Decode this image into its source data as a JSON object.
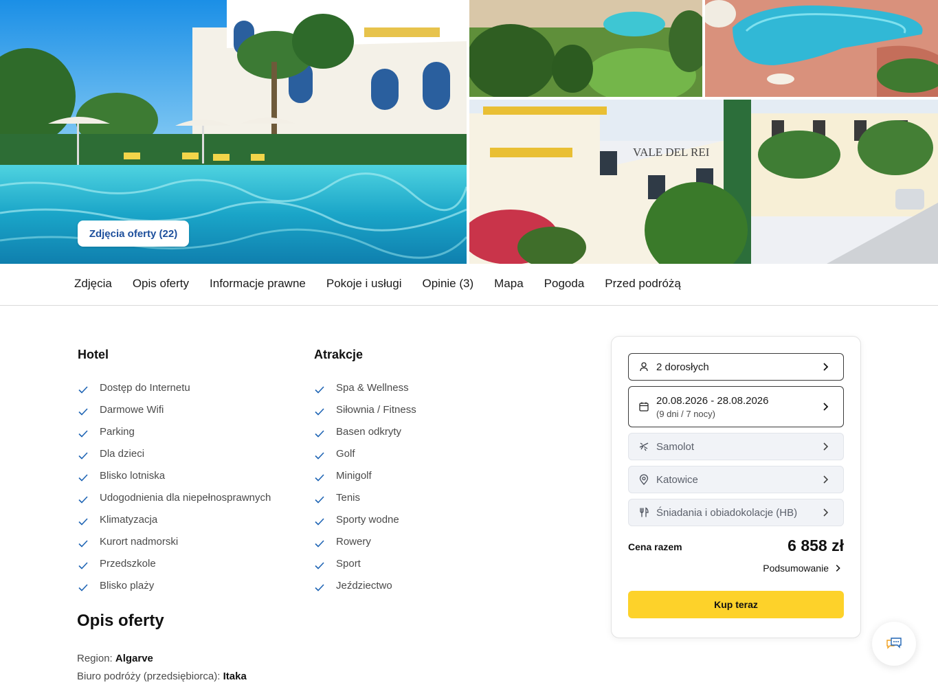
{
  "gallery": {
    "photos_button": "Zdjęcia oferty (22)",
    "sign_text": "VALE DEL REI"
  },
  "tabs": [
    {
      "label": "Zdjęcia"
    },
    {
      "label": "Opis oferty"
    },
    {
      "label": "Informacje prawne"
    },
    {
      "label": "Pokoje i usługi"
    },
    {
      "label": "Opinie (3)"
    },
    {
      "label": "Mapa"
    },
    {
      "label": "Pogoda"
    },
    {
      "label": "Przed podróżą"
    }
  ],
  "amenities": {
    "hotel": {
      "title": "Hotel",
      "items": [
        "Dostęp do Internetu",
        "Darmowe Wifi",
        "Parking",
        "Dla dzieci",
        "Blisko lotniska",
        "Udogodnienia dla niepełnosprawnych",
        "Klimatyzacja",
        "Kurort nadmorski",
        "Przedszkole",
        "Blisko plaży"
      ]
    },
    "attractions": {
      "title": "Atrakcje",
      "items": [
        "Spa & Wellness",
        "Siłownia / Fitness",
        "Basen odkryty",
        "Golf",
        "Minigolf",
        "Tenis",
        "Sporty wodne",
        "Rowery",
        "Sport",
        "Jeździectwo"
      ]
    }
  },
  "opis": {
    "title": "Opis oferty",
    "region_label": "Region:",
    "region_value": "Algarve",
    "operator_label": "Biuro podróży (przedsiębiorca):",
    "operator_value": "Itaka"
  },
  "booking": {
    "travelers": "2 dorosłych",
    "dates": "20.08.2026 - 28.08.2026",
    "duration": "(9 dni / 7 nocy)",
    "transport": "Samolot",
    "departure": "Katowice",
    "board": "Śniadania i obiadokolacje (HB)",
    "total_label": "Cena razem",
    "total_price": "6 858 zł",
    "summary_link": "Podsumowanie",
    "buy_button": "Kup teraz"
  },
  "colors": {
    "accent_yellow": "#fdd22a",
    "link_blue": "#1d4f9c",
    "check_blue": "#1e64b4"
  },
  "icons": {
    "travelers": "person-icon",
    "dates": "calendar-icon",
    "transport": "plane-icon",
    "departure": "location-pin-icon",
    "board": "cutlery-icon",
    "chat": "chat-icon"
  }
}
